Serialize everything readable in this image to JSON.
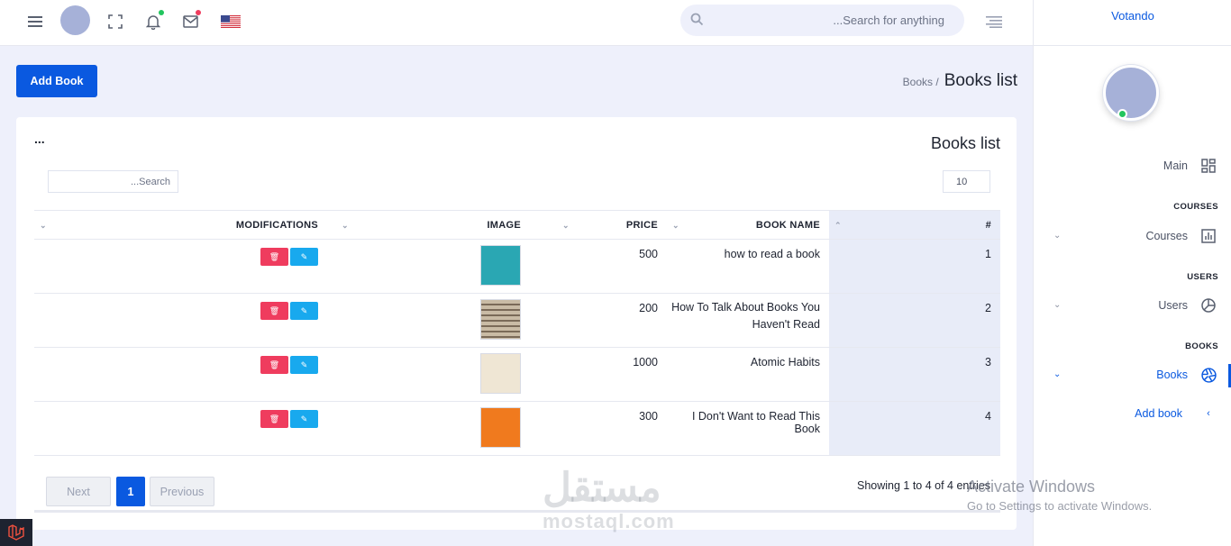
{
  "topbar": {
    "search_placeholder": "...Search for anything",
    "icons": [
      "menu-icon",
      "avatar",
      "fullscreen-icon",
      "bell-icon",
      "mail-icon",
      "us-flag-icon",
      "search-icon",
      "align-right-icon"
    ],
    "notification_dot_color": "#22c55e",
    "mail_dot_color": "#ef3c5e"
  },
  "sidebar": {
    "brand": "Votando",
    "online_color": "#22c55e",
    "main_label": "Main",
    "sections": [
      {
        "heading": "COURSES",
        "item": "Courses"
      },
      {
        "heading": "USERS",
        "item": "Users"
      },
      {
        "heading": "BOOKS",
        "item": "Books"
      }
    ],
    "sub_item": "Add book"
  },
  "page": {
    "add_button": "Add Book",
    "breadcrumb_parent": "Books /",
    "breadcrumb_current": "Books list",
    "accent": "#0a59e0"
  },
  "card": {
    "dots": "...",
    "title": "Books list",
    "search_placeholder": "...Search",
    "page_length": "10",
    "columns": {
      "modifications": "MODIFICATIONS",
      "image": "IMAGE",
      "price": "PRICE",
      "name": "BOOK NAME",
      "num": "#"
    },
    "rows": [
      {
        "num": "1",
        "name": "how to read a book",
        "price": "500",
        "cover_color": "#2aa7b3"
      },
      {
        "num": "2",
        "name": "How To Talk About Books You Haven't Read",
        "price": "200",
        "cover_color": "#c9bba5"
      },
      {
        "num": "3",
        "name": "Atomic Habits",
        "price": "1000",
        "cover_color": "#efe6d4"
      },
      {
        "num": "4",
        "name": "I Don't Want to Read This Book",
        "price": "300",
        "cover_color": "#f07a1e"
      }
    ],
    "pagination": {
      "next": "Next",
      "current": "1",
      "previous": "Previous"
    },
    "showing": "Showing 1 to 4 of 4 entries"
  },
  "overlay": {
    "watermark": "مستقل",
    "watermark_sub": "mostaql.com",
    "activate_title": "Activate Windows",
    "activate_sub": "Go to Settings to activate Windows."
  }
}
